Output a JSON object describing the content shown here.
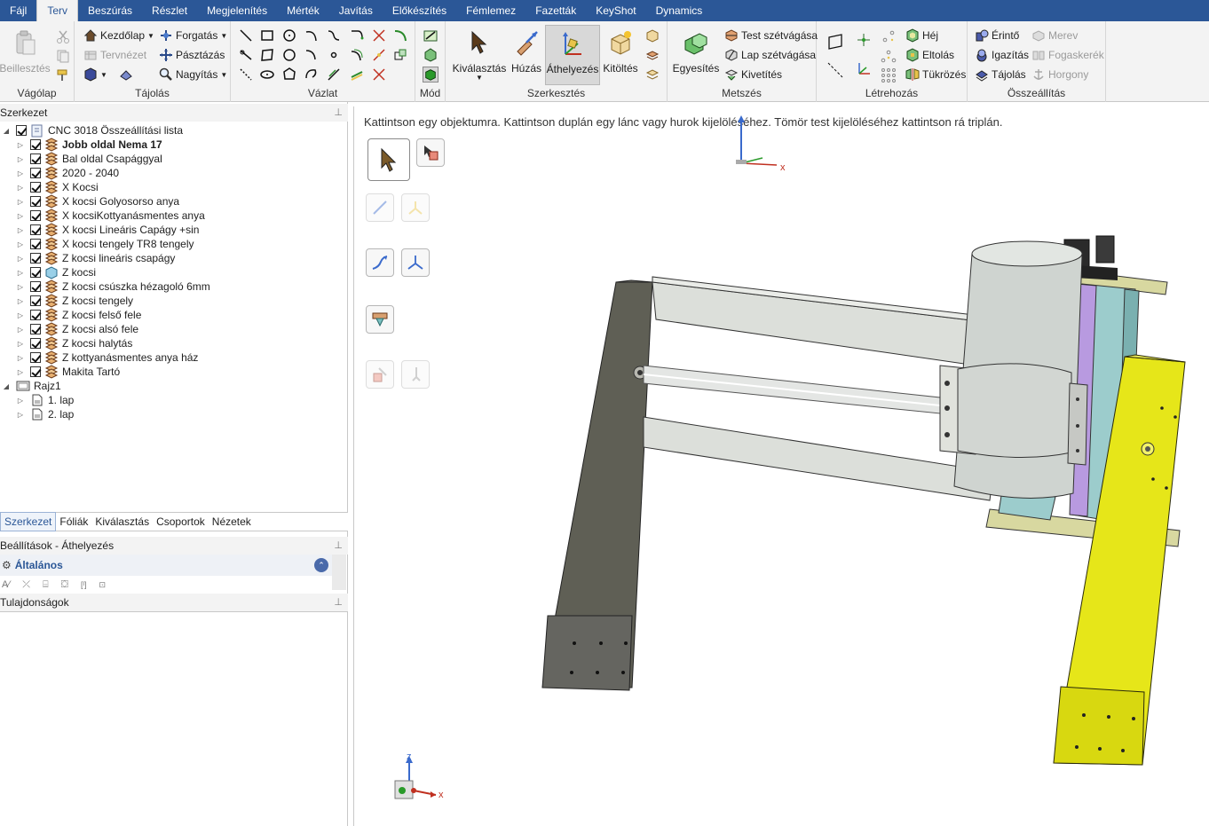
{
  "menu": {
    "items": [
      "Fájl",
      "Terv",
      "Beszúrás",
      "Részlet",
      "Megjelenítés",
      "Mérték",
      "Javítás",
      "Előkészítés",
      "Fémlemez",
      "Fazetták",
      "KeyShot",
      "Dynamics"
    ],
    "active": "Terv"
  },
  "ribbon": {
    "clipboard": {
      "label": "Vágólap",
      "paste": "Beillesztés"
    },
    "orient": {
      "label": "Tájolás",
      "home": "Kezdőlap",
      "plan": "Tervnézet",
      "spin": "Forgatás",
      "pan": "Pásztázás",
      "zoom": "Nagyítás"
    },
    "sketch": {
      "label": "Vázlat"
    },
    "mode": {
      "label": "Mód"
    },
    "edit": {
      "label": "Szerkesztés",
      "select": "Kiválasztás",
      "pull": "Húzás",
      "move": "Áthelyezés",
      "fill": "Kitöltés"
    },
    "intersect": {
      "label": "Metszés",
      "combine": "Egyesítés",
      "split_body": "Test szétvágása",
      "split_face": "Lap szétvágása",
      "project": "Kivetítés"
    },
    "create": {
      "label": "Létrehozás",
      "shell": "Héj",
      "offset": "Eltolás",
      "mirror": "Tükrözés"
    },
    "assembly": {
      "label": "Összeállítás",
      "tangent": "Érintő",
      "align": "Igazítás",
      "orient": "Tájolás",
      "rigid": "Merev",
      "gear": "Fogaskerék",
      "anchor": "Horgony"
    }
  },
  "structure_panel": {
    "title": "Szerkezet",
    "root": "CNC 3018 Összeállítási lista",
    "items": [
      {
        "label": "Jobb oldal Nema 17",
        "bold": true
      },
      {
        "label": "Bal oldal Csapággyal",
        "bold": false
      },
      {
        "label": "2020 - 2040",
        "bold": false
      },
      {
        "label": "X Kocsi",
        "bold": false
      },
      {
        "label": "X kocsi Golyosorso anya",
        "bold": false
      },
      {
        "label": "X kocsiKottyanásmentes anya",
        "bold": false
      },
      {
        "label": "X kocsi Lineáris Capágy +sin",
        "bold": false
      },
      {
        "label": "X kocsi tengely TR8 tengely",
        "bold": false
      },
      {
        "label": "Z kocsi lineáris csapágy",
        "bold": false
      },
      {
        "label": "Z kocsi",
        "bold": false
      },
      {
        "label": "Z kocsi csúszka hézagoló 6mm",
        "bold": false
      },
      {
        "label": "Z kocsi tengely",
        "bold": false
      },
      {
        "label": "Z kocsi felső fele",
        "bold": false
      },
      {
        "label": "Z kocsi alsó fele",
        "bold": false
      },
      {
        "label": "Z kocsi halytás",
        "bold": false
      },
      {
        "label": "Z kottyanásmentes anya ház",
        "bold": false
      },
      {
        "label": "Makita Tartó",
        "bold": false
      }
    ],
    "drawing": "Rajz1",
    "sheets": [
      "1. lap",
      "2. lap"
    ]
  },
  "panel_tabs": [
    "Szerkezet",
    "Fóliák",
    "Kiválasztás",
    "Csoportok",
    "Nézetek"
  ],
  "options_panel": {
    "title": "Beállítások - Áthelyezés",
    "section": "Általános"
  },
  "properties_panel": {
    "title": "Tulajdonságok"
  },
  "viewport": {
    "hint": "Kattintson egy objektumra.  Kattintson duplán egy lánc vagy hurok kijelöléséhez.  Tömör test kijelöléséhez kattintson rá triplán.",
    "axis_x": "x",
    "axis_z": "z"
  },
  "colors": {
    "menubar": "#2b5797",
    "ribbon": "#f3f3f3",
    "selected_part": "#e6e619",
    "frame": "#5f5f55",
    "cylinder": "#cfd4d0"
  }
}
